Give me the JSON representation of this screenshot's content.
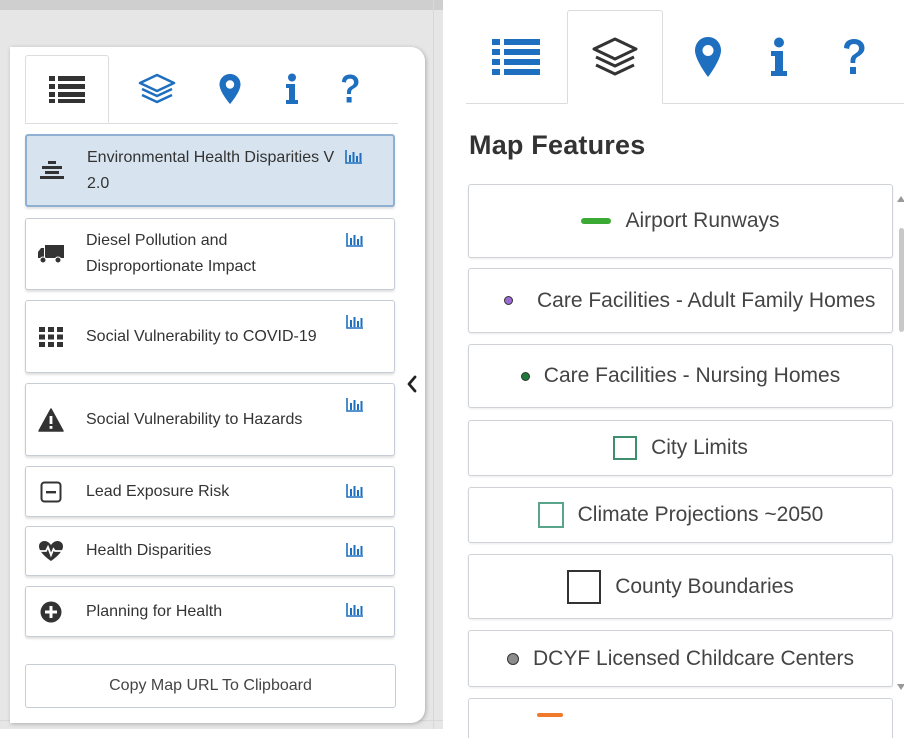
{
  "left_panel": {
    "tabs": [
      {
        "name": "legend",
        "icon": "list-icon",
        "active": true
      },
      {
        "name": "layers",
        "icon": "layers-icon",
        "active": false
      },
      {
        "name": "location",
        "icon": "map-marker-icon",
        "active": false
      },
      {
        "name": "info",
        "icon": "info-icon",
        "active": false
      },
      {
        "name": "help",
        "icon": "question-icon",
        "active": false
      }
    ],
    "layers": [
      {
        "label": "Environmental Health Disparities V 2.0",
        "icon": "stack-icon",
        "selected": true
      },
      {
        "label": "Diesel Pollution and Disproportionate Impact",
        "icon": "truck-icon",
        "selected": false
      },
      {
        "label": "Social Vulnerability to COVID-19",
        "icon": "grid-icon",
        "selected": false
      },
      {
        "label": "Social Vulnerability to Hazards",
        "icon": "warning-icon",
        "selected": false
      },
      {
        "label": "Lead Exposure Risk",
        "icon": "minus-square-icon",
        "selected": false
      },
      {
        "label": "Health Disparities",
        "icon": "heartbeat-icon",
        "selected": false
      },
      {
        "label": "Planning for Health",
        "icon": "plus-circle-icon",
        "selected": false
      }
    ],
    "copy_button": "Copy Map URL To Clipboard",
    "chart_icon": "bar-chart-icon",
    "collapse_icon": "chevron-left-icon"
  },
  "right_panel": {
    "tabs": [
      {
        "name": "legend",
        "icon": "list-icon",
        "active": false
      },
      {
        "name": "layers",
        "icon": "layers-icon",
        "active": true
      },
      {
        "name": "location",
        "icon": "map-marker-icon",
        "active": false
      },
      {
        "name": "info",
        "icon": "info-icon",
        "active": false
      },
      {
        "name": "help",
        "icon": "question-icon",
        "active": false
      }
    ],
    "title": "Map Features",
    "features": [
      {
        "label": "Airport Runways",
        "symbol": "green-line",
        "color": "#3aaa35"
      },
      {
        "label": "Care Facilities - Adult Family Homes",
        "symbol": "purple-dot",
        "color": "#9b6bd3"
      },
      {
        "label": "Care Facilities - Nursing Homes",
        "symbol": "green-dot",
        "color": "#1f7a3a"
      },
      {
        "label": "City Limits",
        "symbol": "teal-square",
        "color": "#3f8f6f"
      },
      {
        "label": "Climate Projections ~2050",
        "symbol": "teal-square-light",
        "color": "#5aa58a"
      },
      {
        "label": "County Boundaries",
        "symbol": "black-square",
        "color": "#333333"
      },
      {
        "label": "DCYF Licensed Childcare Centers",
        "symbol": "gray-dot",
        "color": "#8c8c8c"
      }
    ]
  },
  "colors": {
    "icon_blue": "#1f6fc0",
    "selected_bg": "#d7e3ef",
    "selected_border": "#8fb0d3"
  }
}
